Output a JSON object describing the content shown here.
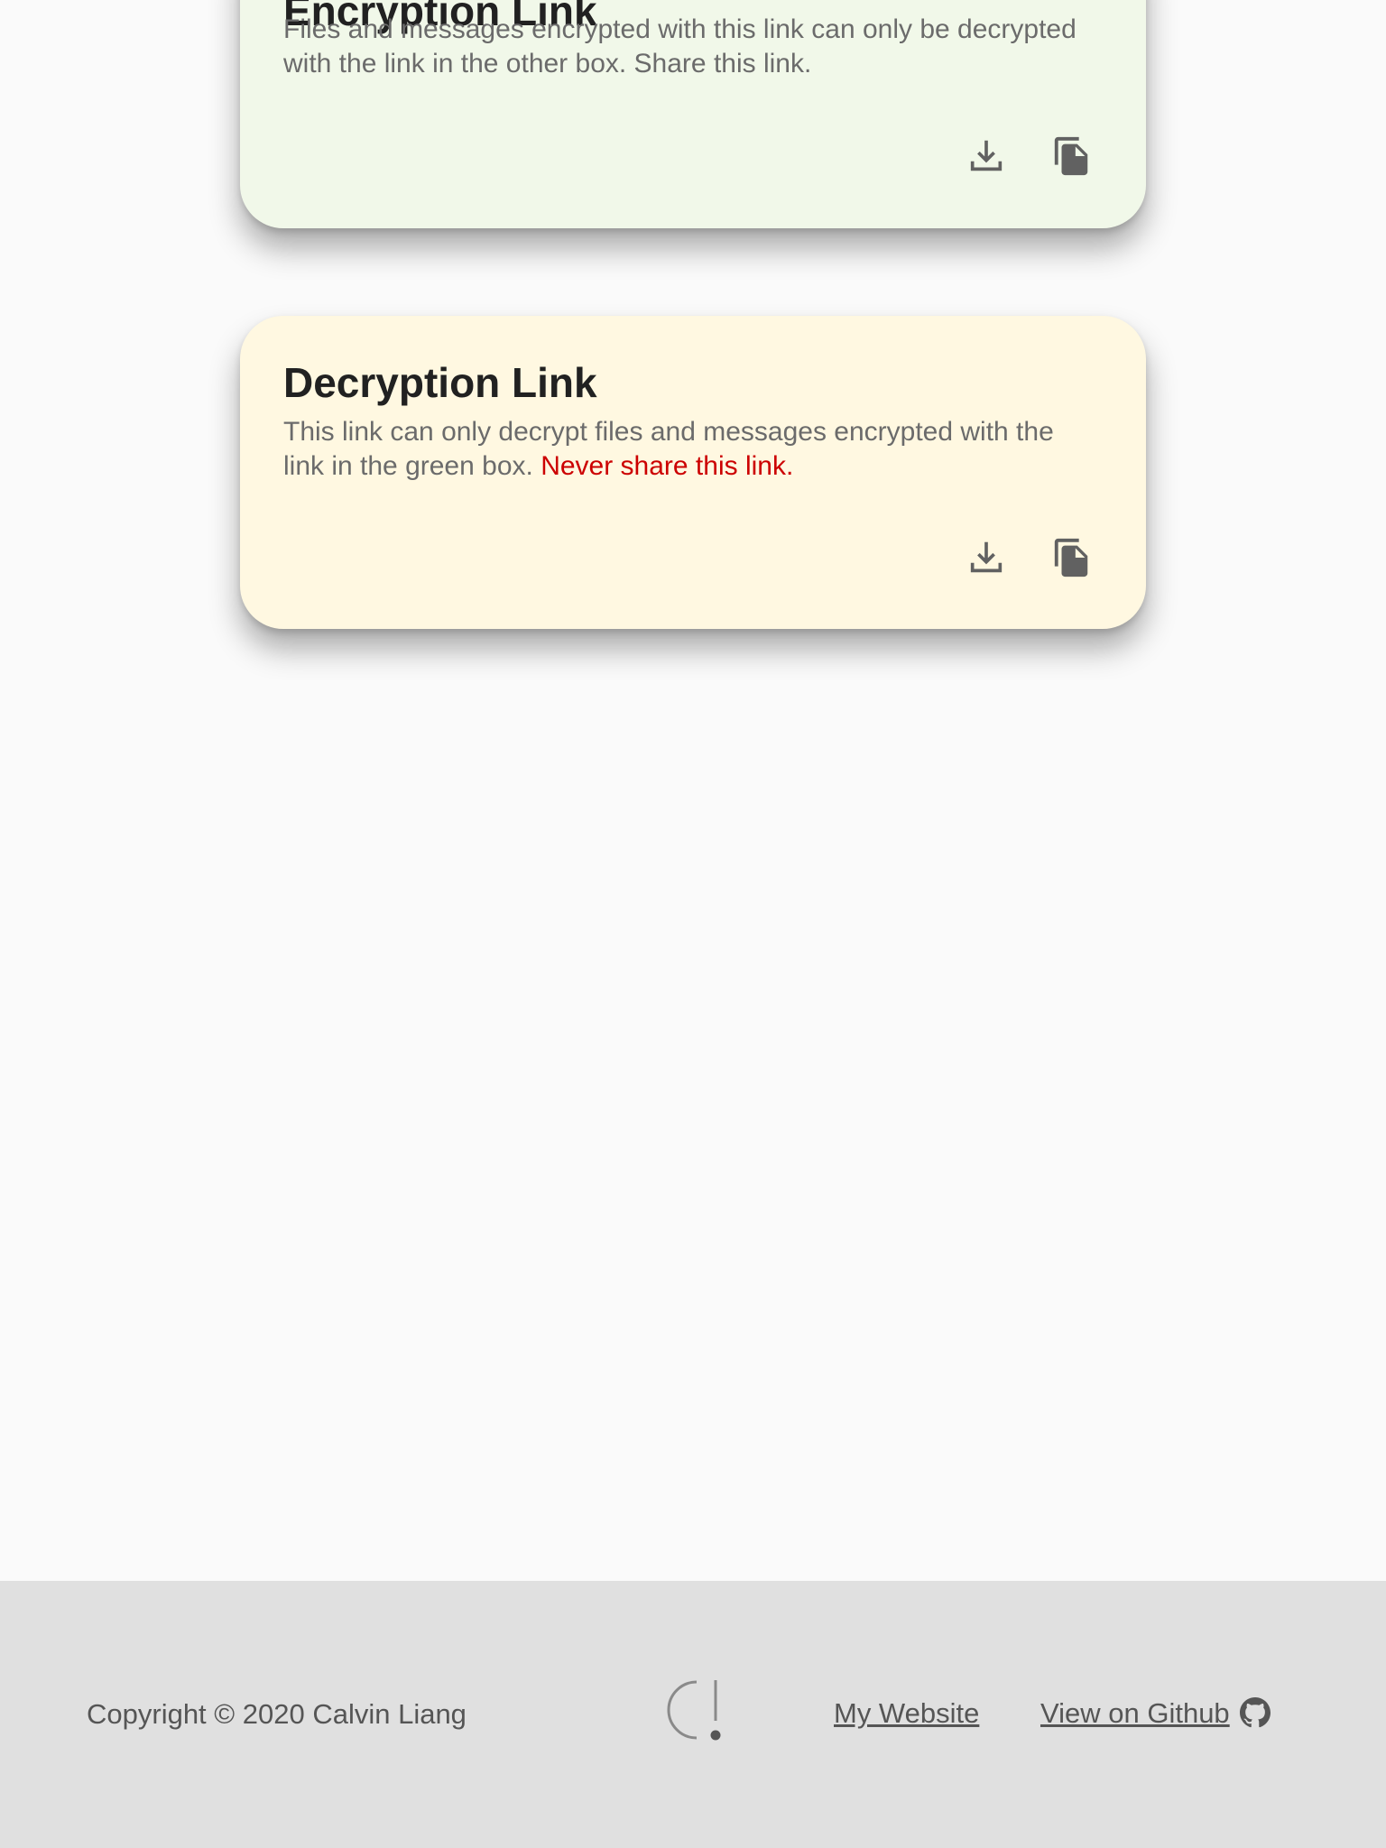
{
  "encryption_card": {
    "title": "Encryption Link",
    "description": "Files and messages encrypted with this link can only be decrypted with the link in the other box. Share this link.",
    "background": "#f1f8e9"
  },
  "decryption_card": {
    "title": "Decryption Link",
    "description": "This link can only decrypt files and messages encrypted with the link in the green box. ",
    "warning": "Never share this link.",
    "background": "#fff8e1",
    "warning_color": "#cc0000"
  },
  "icons": {
    "download": "download-icon",
    "copy": "copy-icon",
    "github": "github-icon",
    "logo": "logo-icon"
  },
  "footer": {
    "copyright": "Copyright © 2020 Calvin Liang",
    "my_website": "My Website",
    "github": "View on Github ",
    "background": "#e0e0e0"
  }
}
